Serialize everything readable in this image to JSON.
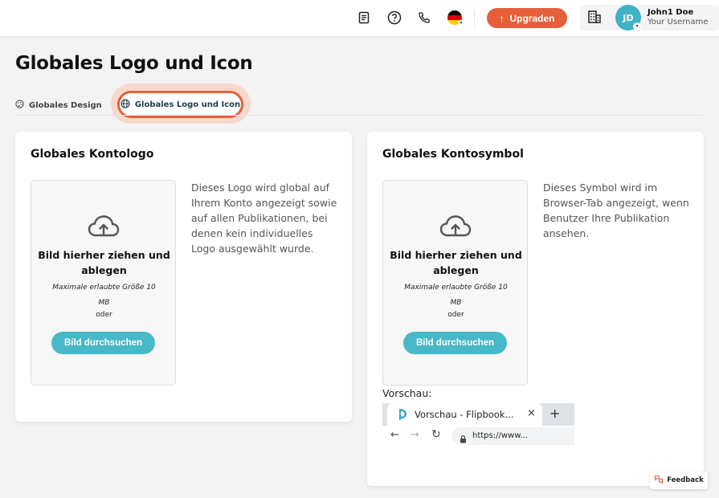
{
  "header": {
    "upgrade_label": "Upgraden",
    "user": {
      "initials": "JD",
      "name": "John1 Doe",
      "username": "Your Username"
    },
    "icons": [
      "document-icon",
      "help-icon",
      "phone-icon",
      "german-flag-icon",
      "building-icon"
    ]
  },
  "page": {
    "title": "Globales Logo und Icon",
    "tabs": [
      {
        "label": "Globales Design",
        "icon": "palette-icon",
        "active": false
      },
      {
        "label": "Globales Logo und Icon",
        "icon": "globe-icon",
        "active": true
      }
    ]
  },
  "logo_card": {
    "title": "Globales Kontologo",
    "drop_title": "Bild hierher ziehen und ablegen",
    "max_size": "Maximale erlaubte Größe 10 MB",
    "or": "oder",
    "browse_label": "Bild durchsuchen",
    "description": "Dieses Logo wird global auf Ihrem Konto angezeigt sowie auf allen Publikationen, bei denen kein individuelles Logo ausgewählt wurde."
  },
  "icon_card": {
    "title": "Globales Kontosymbol",
    "drop_title": "Bild hierher ziehen und ablegen",
    "max_size": "Maximale erlaubte Größe 10 MB",
    "or": "oder",
    "browse_label": "Bild durchsuchen",
    "description": "Dieses Symbol wird im Browser-Tab angezeigt, wenn Benutzer Ihre Publikation ansehen.",
    "preview_label": "Vorschau:",
    "preview": {
      "tab_title": "Vorschau - Flipbook...",
      "close": "×",
      "new_tab": "+",
      "url": "https://www..."
    }
  },
  "feedback_label": "Feedback",
  "colors": {
    "accent": "#e5603a",
    "teal": "#47b8c8",
    "avatar": "#3fb2c4"
  }
}
